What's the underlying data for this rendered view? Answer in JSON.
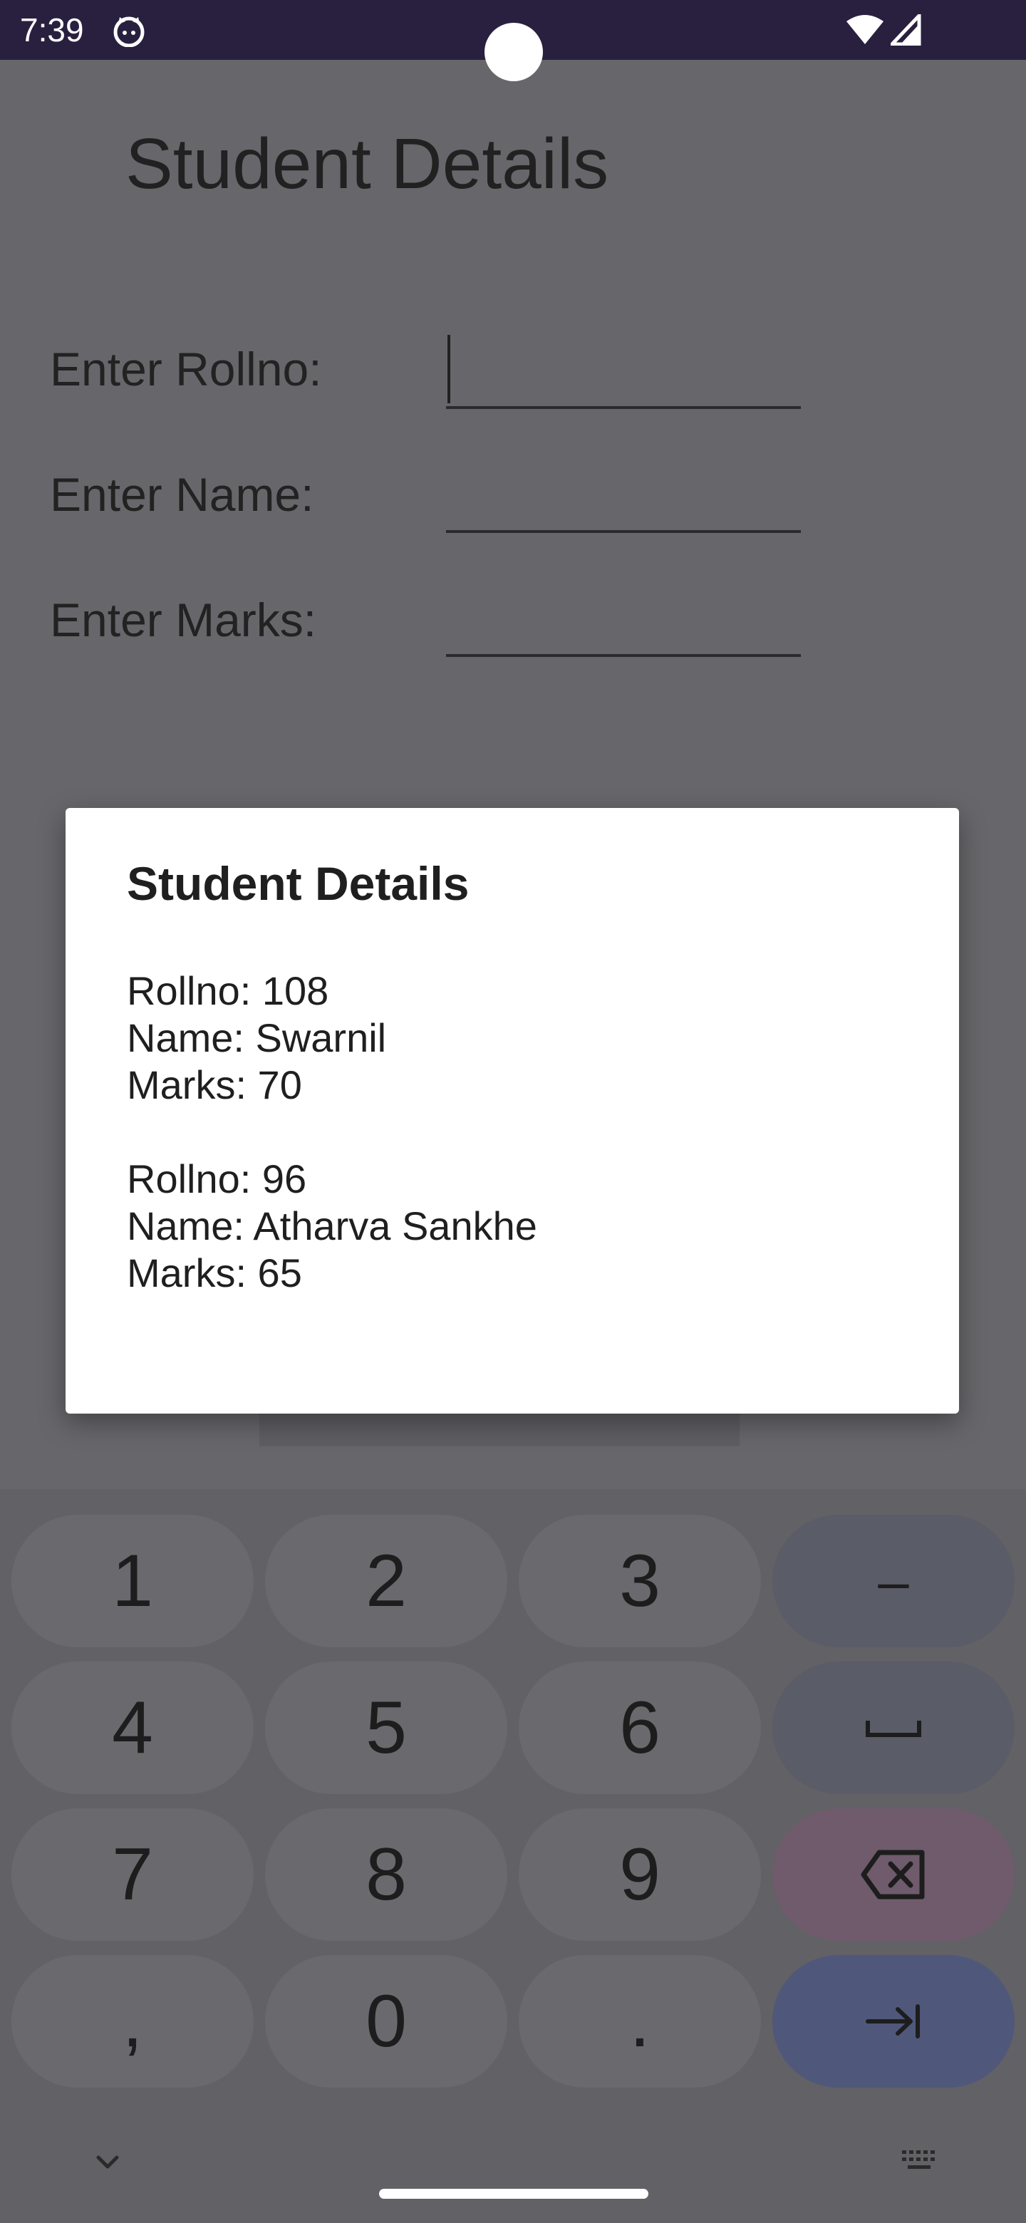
{
  "status_bar": {
    "time": "7:39",
    "app_icon": "android-cat-icon",
    "wifi_icon": "wifi-icon",
    "signal_icon": "cell-signal-icon"
  },
  "app": {
    "title": "Student Details",
    "form": {
      "rollno_label": "Enter Rollno:",
      "rollno_value": "",
      "name_label": "Enter Name:",
      "name_value": "",
      "marks_label": "Enter Marks:",
      "marks_value": ""
    }
  },
  "dialog": {
    "title": "Student Details",
    "lines": [
      "Rollno: 108",
      "Name: Swarnil",
      "Marks: 70",
      "Rollno: 96",
      "Name: Atharva Sankhe",
      "Marks: 65"
    ]
  },
  "keyboard": {
    "keys": [
      "1",
      "2",
      "3",
      "–",
      "4",
      "5",
      "6",
      "␣",
      "7",
      "8",
      "9",
      "⌫",
      ",",
      "0",
      ".",
      "⇥"
    ],
    "icons": {
      "space": "space-bar-icon",
      "backspace": "backspace-icon",
      "enter": "tab-next-icon",
      "collapse": "chevron-down-icon",
      "switch": "keyboard-icon"
    }
  },
  "colors": {
    "status_bar": "#29203f",
    "scrim": "#67666a",
    "dialog_bg": "#ffffff",
    "enter_key": "#4f587a",
    "delete_key": "#6f5b6c"
  }
}
